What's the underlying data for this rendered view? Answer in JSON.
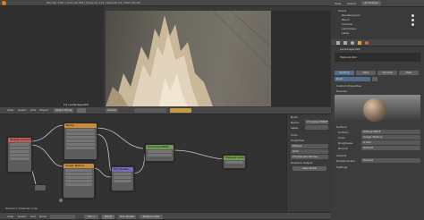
{
  "topbar": {
    "info": "Blender 2.80 | Verts:42,558 | Faces:42,113 | Objects:1/3 | Mem:26.1M"
  },
  "viewport": {
    "info": "(1) Landscape.003",
    "overlay": "User Perspective"
  },
  "viewport_header": {
    "menus": [
      "View",
      "Select",
      "Add",
      "Object"
    ],
    "mode": "Object Mode",
    "shading": "Global"
  },
  "node_header": {
    "menus": [
      "View",
      "Select",
      "Add",
      "Node"
    ],
    "use_nodes": "Use Nodes",
    "slot": "Slot 1",
    "material": "Rock",
    "node_tree": "Material.002"
  },
  "status_bar": {
    "text": "Dielectric Material node",
    "frame": "1"
  },
  "nodes": {
    "texcoord": "Texture Coordinate",
    "bump": "Bump",
    "image": "Image Texture",
    "mix": "Mix Shader",
    "principled": "Principled BSDF",
    "output": "Material Output"
  },
  "n_panel": {
    "node_label": "Node",
    "name_label": "Name:",
    "name_value": "Principled BSDF",
    "label_label": "Label:",
    "color_section": "Color",
    "properties_section": "Properties",
    "inputs": [
      "Diffuse",
      "GGX",
      "Christensen-Burley"
    ],
    "extra_section": "Displace Output",
    "new_node": "New Node"
  },
  "outliner": {
    "header": [
      "View",
      "Search",
      "All Scenes"
    ],
    "items": [
      "Scene",
      "RenderLayers",
      "World",
      "Camera",
      "Landscape",
      "Lamp"
    ]
  },
  "properties": {
    "breadcrumb": "Landscape.003",
    "material_slot": "Material.002",
    "tabs": [
      "Surface",
      "Wire",
      "Volume",
      "Halo"
    ],
    "material_name": "Rock",
    "preview_section": "Preview",
    "custom_props": "Custom Properties",
    "surface_section": "Surface",
    "surface_label": "Surface",
    "surface_value": "Diffuse BSDF",
    "color_label": "Color",
    "color_value": "Image Texture",
    "roughness_label": "Roughness",
    "roughness_value": "0.500",
    "normal_label": "Normal",
    "normal_value": "Default",
    "volume_section": "Volume",
    "displacement_section": "Displacement",
    "displacement_value": "Default",
    "settings_section": "Settings"
  },
  "colors": {
    "shader_header": "#6f9a4f",
    "texture_header": "#c98a3a",
    "vector_header": "#7a6bb8",
    "output_header": "#b44040",
    "link": "#c8c8c8"
  }
}
